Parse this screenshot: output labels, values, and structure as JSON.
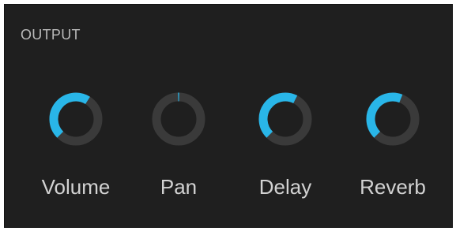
{
  "section": {
    "title": "OUTPUT"
  },
  "colors": {
    "panel_bg": "#1f1f1f",
    "track": "#3a3a3a",
    "accent": "#29b6e8",
    "label": "#d2d2d2",
    "title": "#b9b9b9"
  },
  "knobs": [
    {
      "label": "Volume",
      "value": 0.62
    },
    {
      "label": "Pan",
      "value": 0.5,
      "bipolar": true
    },
    {
      "label": "Delay",
      "value": 0.6
    },
    {
      "label": "Reverb",
      "value": 0.58
    }
  ]
}
